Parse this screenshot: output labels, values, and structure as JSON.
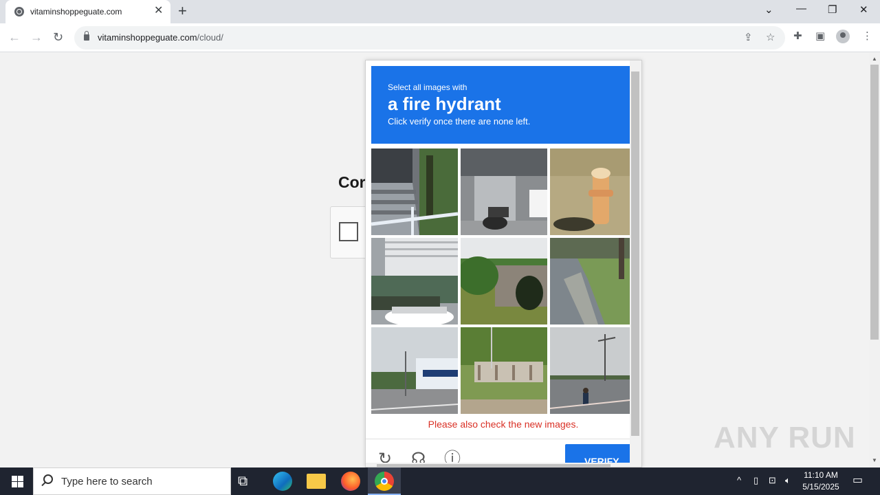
{
  "browser": {
    "tab_title": "vitaminshoppeguate.com",
    "tab_close": "✕",
    "new_tab": "+",
    "url_host": "vitaminshoppeguate.com",
    "url_path": "/cloud/"
  },
  "page": {
    "title_partial": "Cor"
  },
  "captcha": {
    "instruction_small": "Select all images with",
    "target_object": "a fire hydrant",
    "instruction_hint": "Click verify once there are none left.",
    "error_message": "Please also check the new images.",
    "verify_label": "VERIFY",
    "tiles": [
      {
        "content": "stairs with railing"
      },
      {
        "content": "scooter near building"
      },
      {
        "content": "fire hydrant"
      },
      {
        "content": "building and car"
      },
      {
        "content": "stone bridge arch"
      },
      {
        "content": "curb and grass"
      },
      {
        "content": "street with building"
      },
      {
        "content": "fence and trees"
      },
      {
        "content": "road with cyclist"
      }
    ]
  },
  "watermark": "ANY RUN",
  "taskbar": {
    "search_placeholder": "Type here to search",
    "time": "11:10 AM",
    "date": "5/15/2025"
  },
  "colors": {
    "captcha_blue": "#1a73e8",
    "error_red": "#d93025"
  }
}
